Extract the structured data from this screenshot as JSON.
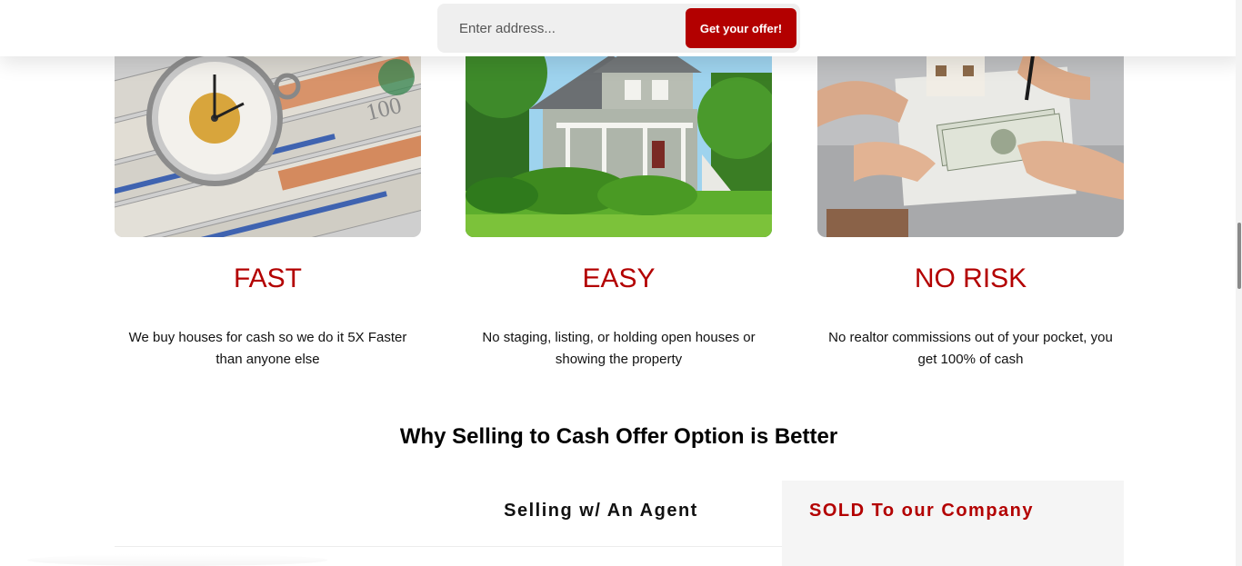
{
  "header": {
    "address_placeholder": "Enter address...",
    "cta_label": "Get your offer!"
  },
  "features": [
    {
      "title": "FAST",
      "text": "We buy houses for cash so we do it 5X Faster than anyone else",
      "image": "cash-and-pocket-watch-image"
    },
    {
      "title": "EASY",
      "text": "No staging, listing, or holding open houses or showing the property",
      "image": "house-with-garden-image"
    },
    {
      "title": "NO RISK",
      "text": "No realtor commissions out of your pocket, you get 100% of cash",
      "image": "cash-handover-house-model-image"
    }
  ],
  "comparison": {
    "title": "Why Selling to Cash Offer Option is Better",
    "agent_column": "Selling w/ An Agent",
    "company_column": "SOLD To our Company"
  },
  "colors": {
    "accent": "#b30000",
    "background": "#ffffff",
    "form_background": "#efefef"
  }
}
